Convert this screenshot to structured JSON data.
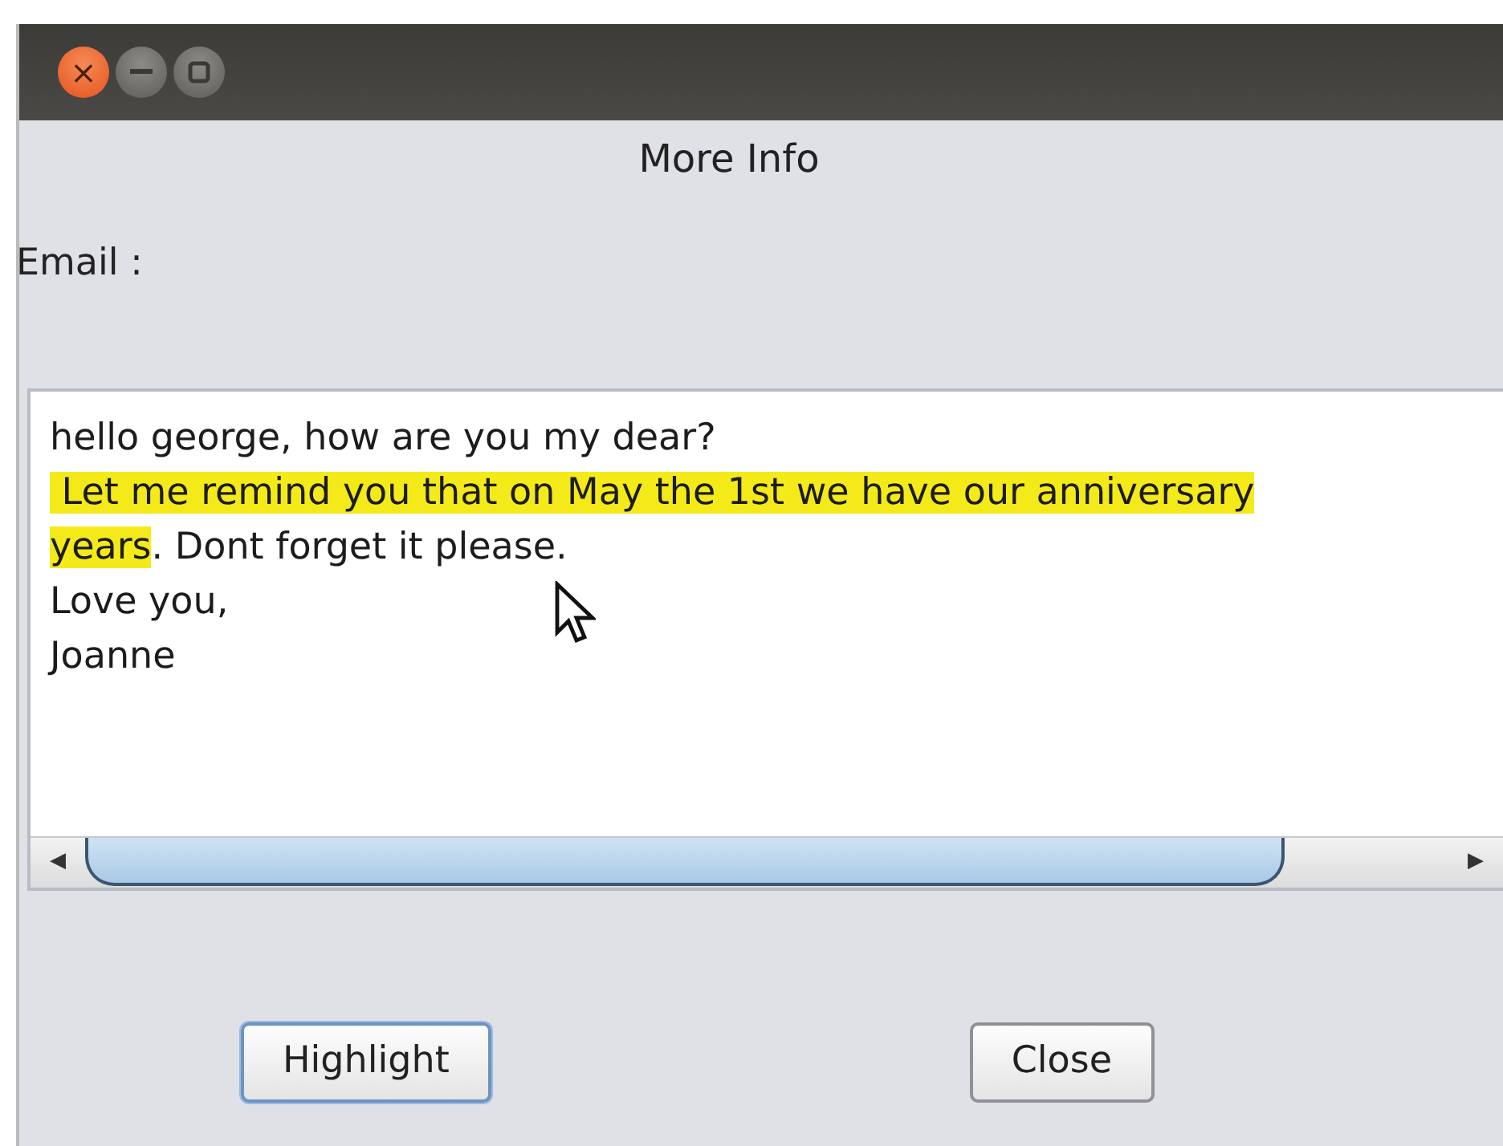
{
  "window": {
    "controls": [
      {
        "kind": "close",
        "symbol": "×"
      },
      {
        "kind": "minimize"
      },
      {
        "kind": "maximize"
      }
    ]
  },
  "heading": "More Info",
  "email_label": "Email :",
  "message": {
    "lines": [
      [
        {
          "text": "hello george, how are you my dear?",
          "highlighted": false
        }
      ],
      [
        {
          "text": " Let me remind you that on May the 1st we have our anniversary",
          "highlighted": true
        }
      ],
      [
        {
          "text": "years",
          "highlighted": true
        },
        {
          "text": ". Dont forget it please.",
          "highlighted": false
        }
      ],
      [
        {
          "text": "Love you,",
          "highlighted": false
        }
      ],
      [
        {
          "text": "Joanne",
          "highlighted": false
        }
      ]
    ],
    "scrollbar": {
      "left_arrow": "◀",
      "right_arrow": "▶"
    }
  },
  "buttons": [
    {
      "label": "Highlight",
      "focused": true
    },
    {
      "label": "Close",
      "focused": false
    }
  ]
}
